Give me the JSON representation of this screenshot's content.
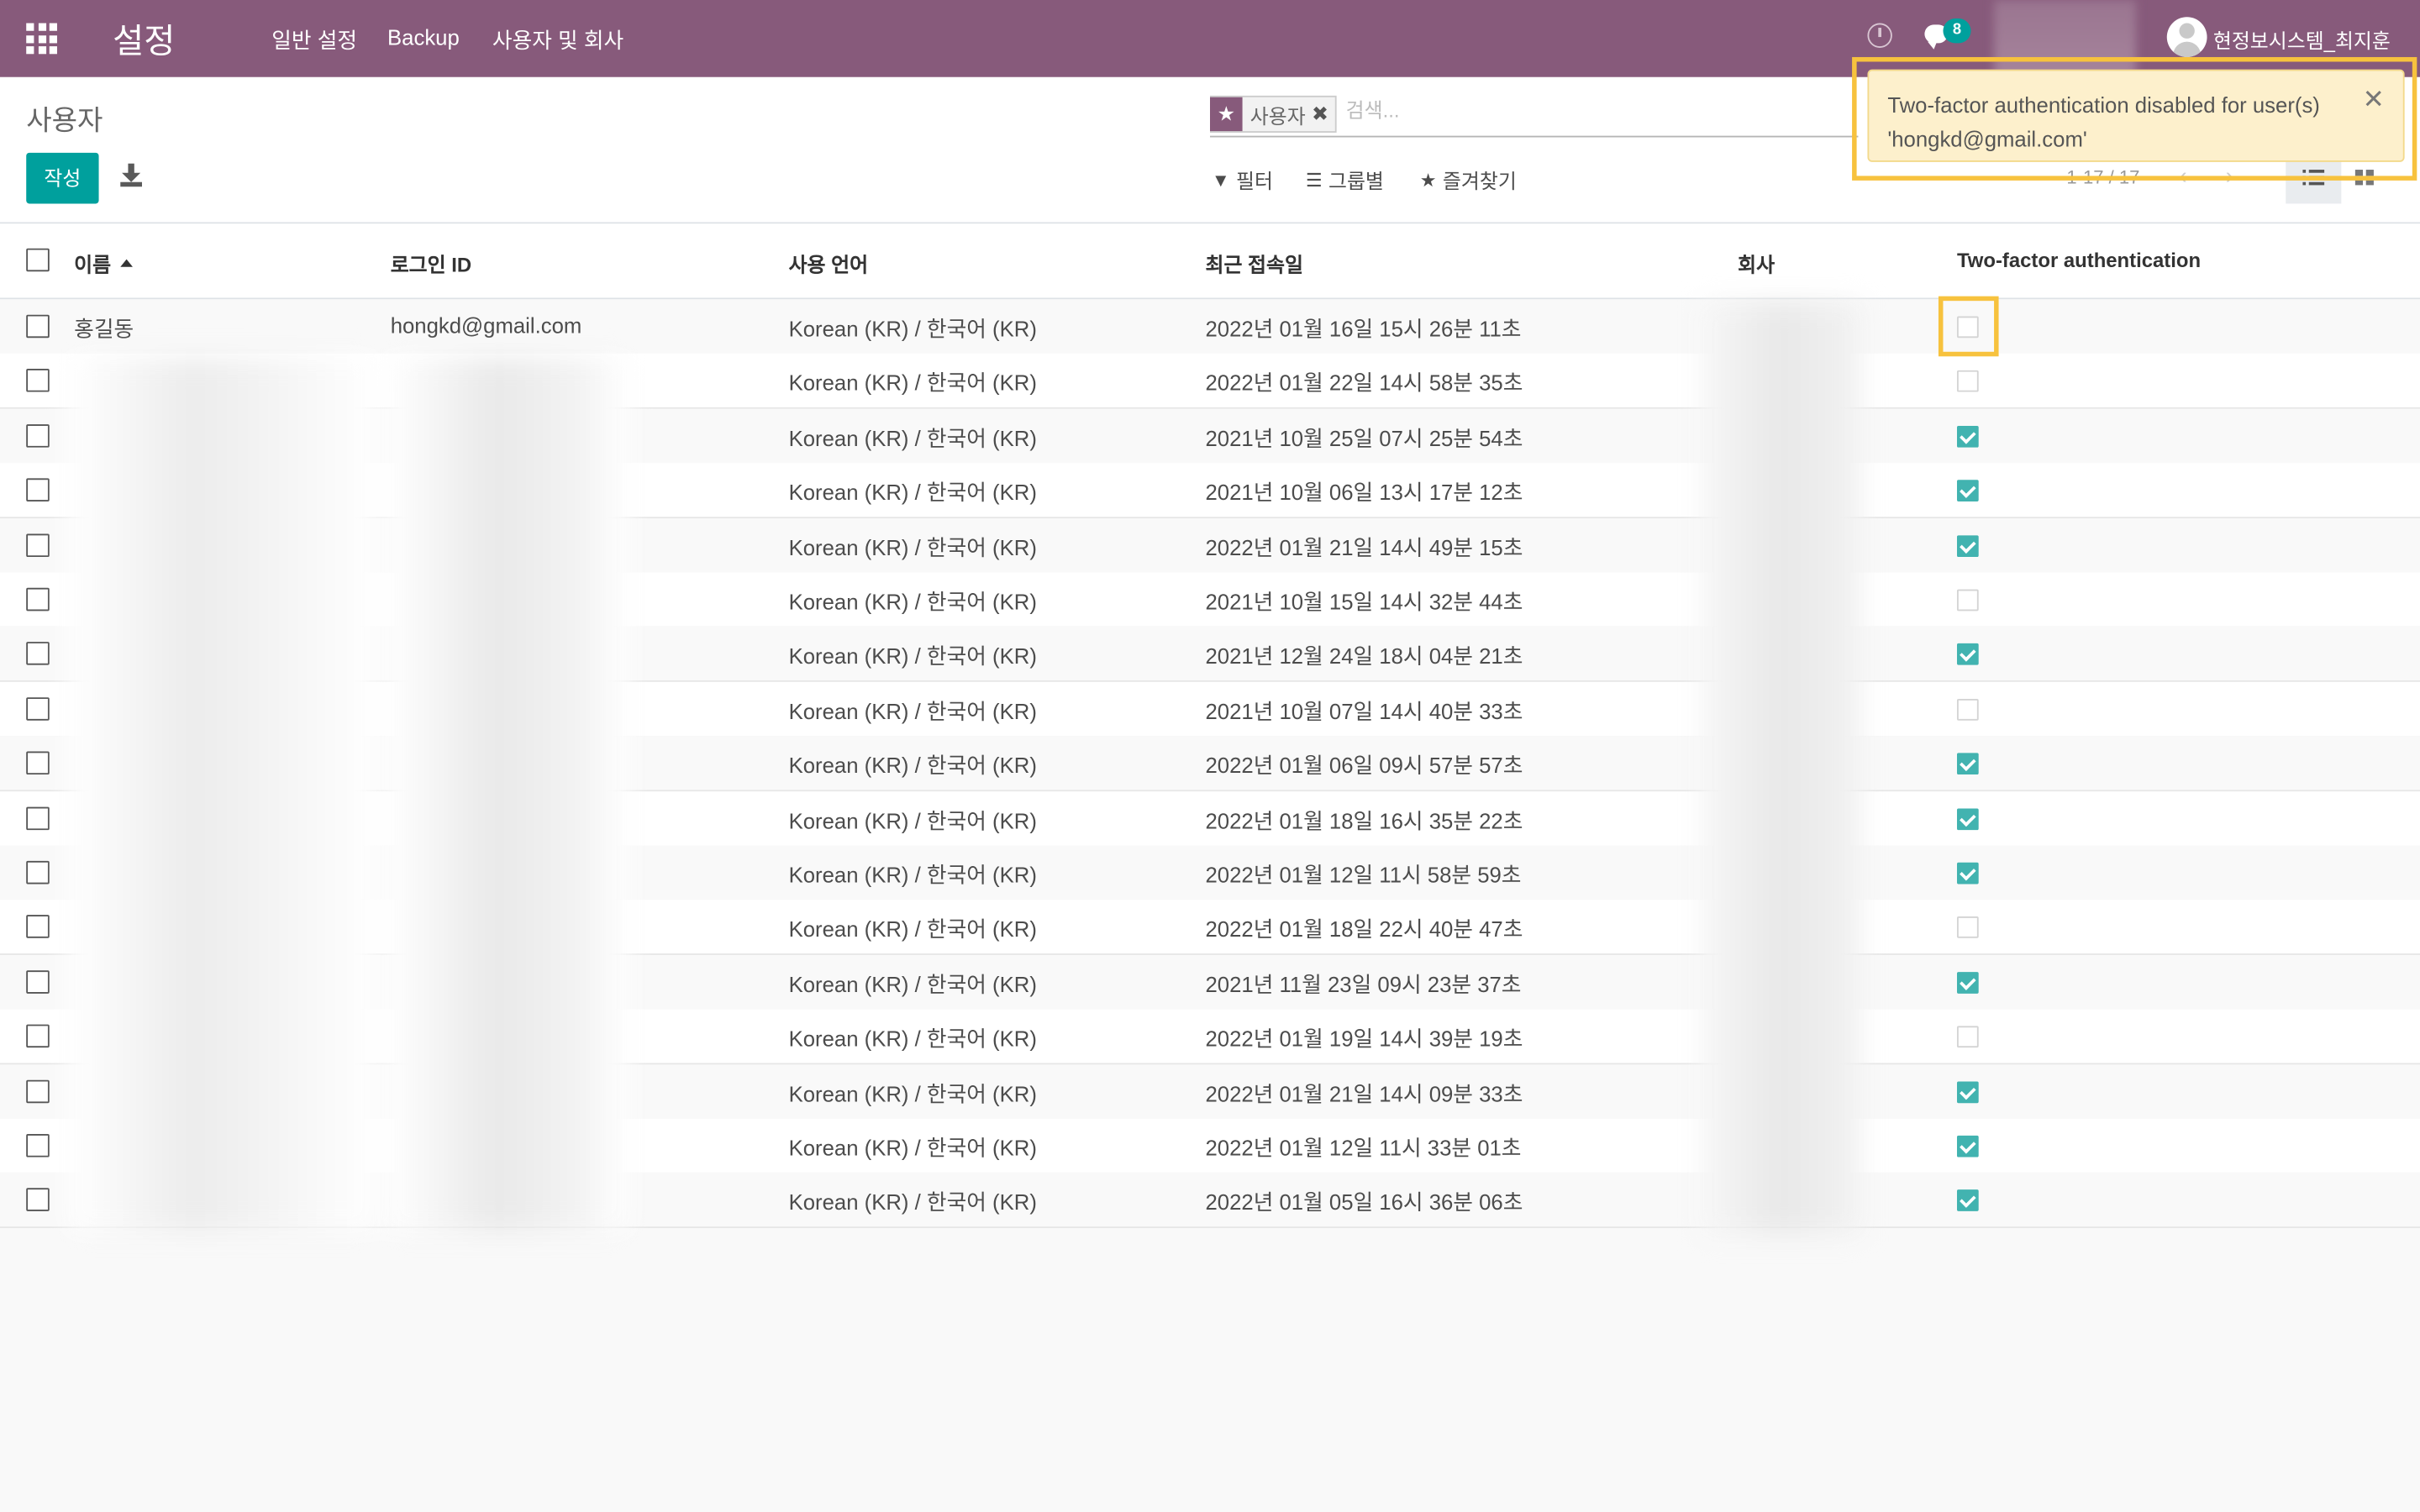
{
  "navbar": {
    "app_title": "설정",
    "menu": [
      "일반 설정",
      "Backup",
      "사용자 및 회사"
    ],
    "messages_count": "8",
    "user_name": "현정보시스템_최지훈"
  },
  "control_panel": {
    "breadcrumb": "사용자",
    "create_label": "작성",
    "search_facet": "사용자",
    "search_placeholder": "검색...",
    "filter_label": "필터",
    "group_label": "그룹별",
    "favorites_label": "즐겨찾기",
    "pager": "1-17 / 17"
  },
  "notification": {
    "message": "Two-factor authentication disabled for user(s) 'hongkd@gmail.com'"
  },
  "table": {
    "columns": [
      "이름",
      "로그인 ID",
      "사용 언어",
      "최근 접속일",
      "회사",
      "Two-factor authentication"
    ],
    "rows": [
      {
        "name": "홍길동",
        "login": "hongkd@gmail.com",
        "lang": "Korean (KR) / 한국어 (KR)",
        "last_login": "2022년 01월 16일 15시 26분 11초",
        "tfa": false
      },
      {
        "name": "",
        "login": "",
        "lang": "Korean (KR) / 한국어 (KR)",
        "last_login": "2022년 01월 22일 14시 58분 35초",
        "tfa": false
      },
      {
        "name": "",
        "login": "",
        "lang": "Korean (KR) / 한국어 (KR)",
        "last_login": "2021년 10월 25일 07시 25분 54초",
        "tfa": true
      },
      {
        "name": "",
        "login": "",
        "lang": "Korean (KR) / 한국어 (KR)",
        "last_login": "2021년 10월 06일 13시 17분 12초",
        "tfa": true
      },
      {
        "name": "",
        "login": "",
        "lang": "Korean (KR) / 한국어 (KR)",
        "last_login": "2022년 01월 21일 14시 49분 15초",
        "tfa": true
      },
      {
        "name": "",
        "login": "",
        "lang": "Korean (KR) / 한국어 (KR)",
        "last_login": "2021년 10월 15일 14시 32분 44초",
        "tfa": false
      },
      {
        "name": "",
        "login": "",
        "lang": "Korean (KR) / 한국어 (KR)",
        "last_login": "2021년 12월 24일 18시 04분 21초",
        "tfa": true
      },
      {
        "name": "",
        "login": "",
        "lang": "Korean (KR) / 한국어 (KR)",
        "last_login": "2021년 10월 07일 14시 40분 33초",
        "tfa": false
      },
      {
        "name": "",
        "login": "",
        "lang": "Korean (KR) / 한국어 (KR)",
        "last_login": "2022년 01월 06일 09시 57분 57초",
        "tfa": true
      },
      {
        "name": "",
        "login": "",
        "lang": "Korean (KR) / 한국어 (KR)",
        "last_login": "2022년 01월 18일 16시 35분 22초",
        "tfa": true
      },
      {
        "name": "",
        "login": "",
        "lang": "Korean (KR) / 한국어 (KR)",
        "last_login": "2022년 01월 12일 11시 58분 59초",
        "tfa": true
      },
      {
        "name": "",
        "login": "",
        "lang": "Korean (KR) / 한국어 (KR)",
        "last_login": "2022년 01월 18일 22시 40분 47초",
        "tfa": false
      },
      {
        "name": "",
        "login": "",
        "lang": "Korean (KR) / 한국어 (KR)",
        "last_login": "2021년 11월 23일 09시 23분 37초",
        "tfa": true
      },
      {
        "name": "",
        "login": "",
        "lang": "Korean (KR) / 한국어 (KR)",
        "last_login": "2022년 01월 19일 14시 39분 19초",
        "tfa": false
      },
      {
        "name": "",
        "login": "",
        "lang": "Korean (KR) / 한국어 (KR)",
        "last_login": "2022년 01월 21일 14시 09분 33초",
        "tfa": true
      },
      {
        "name": "",
        "login": "",
        "lang": "Korean (KR) / 한국어 (KR)",
        "last_login": "2022년 01월 12일 11시 33분 01초",
        "tfa": true
      },
      {
        "name": "",
        "login": "",
        "lang": "Korean (KR) / 한국어 (KR)",
        "last_login": "2022년 01월 05일 16시 36분 06초",
        "tfa": true
      }
    ]
  },
  "colors": {
    "navbar": "#875a7b",
    "primary": "#00a09d",
    "highlight": "#f7c23e",
    "notification_bg": "#fdf0cc"
  }
}
